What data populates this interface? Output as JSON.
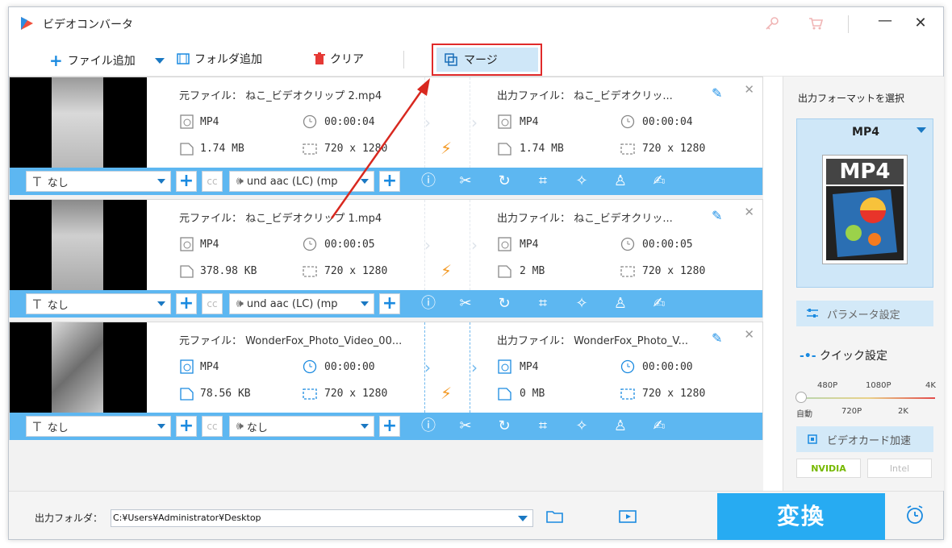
{
  "app": {
    "title": "ビデオコンバータ"
  },
  "toolbar": {
    "add_file": "ファイル追加",
    "add_folder": "フォルダ追加",
    "clear": "クリア",
    "merge": "マージ"
  },
  "labels": {
    "source": "元ファイル：",
    "output": "出力ファイル："
  },
  "files": [
    {
      "source_name": "ねこ_ビデオクリップ 2.mp4",
      "output_name": "ねこ_ビデオクリッ...",
      "src_format": "MP4",
      "src_duration": "00:00:04",
      "src_size": "1.74 MB",
      "src_res": "720 x 1280",
      "out_format": "MP4",
      "out_duration": "00:00:04",
      "out_size": "1.74 MB",
      "out_res": "720 x 1280",
      "subtitle": "なし",
      "audio": "und aac (LC) (mp"
    },
    {
      "source_name": "ねこ_ビデオクリップ 1.mp4",
      "output_name": "ねこ_ビデオクリッ...",
      "src_format": "MP4",
      "src_duration": "00:00:05",
      "src_size": "378.98 KB",
      "src_res": "720 x 1280",
      "out_format": "MP4",
      "out_duration": "00:00:05",
      "out_size": "2 MB",
      "out_res": "720 x 1280",
      "subtitle": "なし",
      "audio": "und aac (LC) (mp"
    },
    {
      "source_name": "WonderFox_Photo_Video_00...",
      "output_name": "WonderFox_Photo_V...",
      "src_format": "MP4",
      "src_duration": "00:00:00",
      "src_size": "78.56 KB",
      "src_res": "720 x 1280",
      "out_format": "MP4",
      "out_duration": "00:00:00",
      "out_size": "0 MB",
      "out_res": "720 x 1280",
      "subtitle": "なし",
      "audio": "なし"
    }
  ],
  "right_panel": {
    "title": "出力フォーマットを選択",
    "format": "MP4",
    "format_badge": "MP4",
    "param_button": "パラメータ設定",
    "quick_title": "クイック設定",
    "quality_top": [
      "480P",
      "1080P",
      "4K"
    ],
    "quality_bottom": [
      "自動",
      "720P",
      "2K"
    ],
    "gpu_button": "ビデオカード加速",
    "vendors": [
      "NVIDIA",
      "Intel"
    ]
  },
  "bottom": {
    "output_label": "出力フォルダ：",
    "output_path": "C:¥Users¥Administrator¥Desktop",
    "convert": "変換"
  },
  "colors": {
    "accent": "#27abf2",
    "bar": "#5db7f1",
    "highlight": "#e02a2a",
    "bolt": "#f39a26"
  }
}
